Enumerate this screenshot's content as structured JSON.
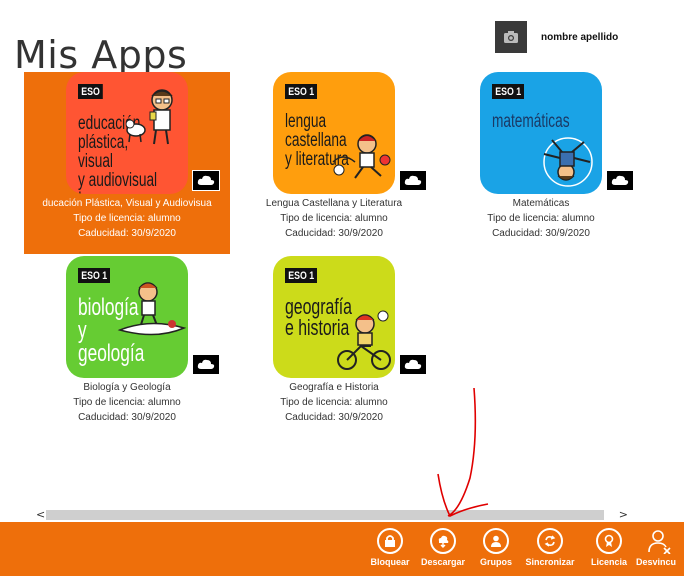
{
  "header": {
    "title": "Mis Apps",
    "user_name": "nombre apellido",
    "avatar_icon": "camera-icon"
  },
  "apps": [
    {
      "id": "plastica",
      "badge": "ESO",
      "subject_text": "educación\nplástica, visual\ny audiovisual I",
      "name": "ducación Plástica, Visual y Audiovisua",
      "license": "Tipo de licencia: alumno",
      "expiry": "Caducidad: 30/9/2020",
      "color": "#ff5533",
      "selected": true
    },
    {
      "id": "lengua",
      "badge": "ESO 1",
      "subject_text": "lengua castellana\ny literatura",
      "name": "Lengua Castellana y Literatura",
      "license": "Tipo de licencia: alumno",
      "expiry": "Caducidad: 30/9/2020",
      "color": "#ff9e0d"
    },
    {
      "id": "mates",
      "badge": "ESO 1",
      "subject_text": "matemáticas",
      "name": "Matemáticas",
      "license": "Tipo de licencia: alumno",
      "expiry": "Caducidad: 30/9/2020",
      "color": "#1aa3e6"
    },
    {
      "id": "biologia",
      "badge": "ESO 1",
      "subject_text": "biología\ny geología",
      "name": "Biología y Geología",
      "license": "Tipo de licencia: alumno",
      "expiry": "Caducidad: 30/9/2020",
      "color": "#66cc33"
    },
    {
      "id": "geografia",
      "badge": "ESO 1",
      "subject_text": "geografía\ne historia",
      "name": "Geografía e Historia",
      "license": "Tipo de licencia: alumno",
      "expiry": "Caducidad: 30/9/2020",
      "color": "#ccdb1a"
    }
  ],
  "scrollbar": {
    "left_arrow": "<",
    "right_arrow": ">"
  },
  "appbar": {
    "color": "#ee6f0b",
    "commands": [
      {
        "label": "Bloquear",
        "icon": "lock-icon"
      },
      {
        "label": "Descargar",
        "icon": "download-icon"
      },
      {
        "label": "Grupos",
        "icon": "group-icon"
      },
      {
        "label": "Sincronizar",
        "icon": "sync-icon"
      },
      {
        "label": "Licencia",
        "icon": "license-icon"
      },
      {
        "label": "Desvincu",
        "icon": "unlink-user-icon"
      }
    ]
  }
}
